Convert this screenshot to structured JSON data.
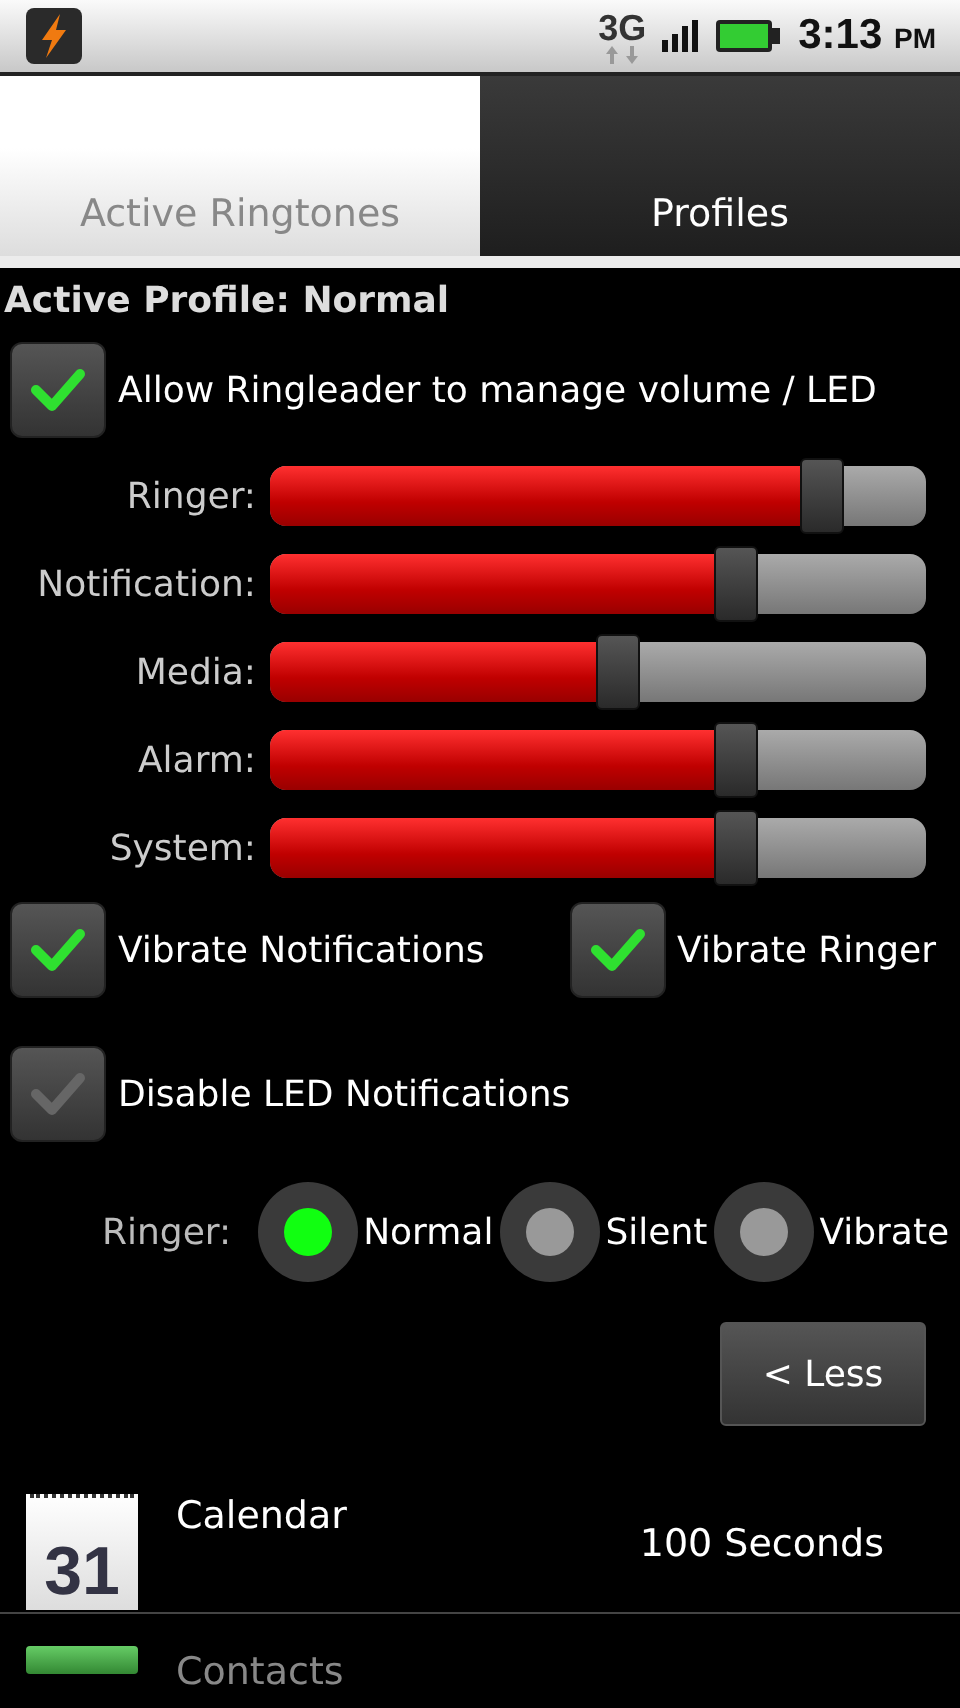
{
  "status_bar": {
    "network": "3G",
    "time": "3:13",
    "ampm": "PM"
  },
  "tabs": [
    {
      "label": "Active Ringtones",
      "selected": false
    },
    {
      "label": "Profiles",
      "selected": true
    }
  ],
  "profile_title": "Active Profile: Normal",
  "manage": {
    "label": "Allow Ringleader to manage volume / LED",
    "checked": true
  },
  "volumes": [
    {
      "name": "Ringer:",
      "level": 0.84
    },
    {
      "name": "Notification:",
      "level": 0.71
    },
    {
      "name": "Media:",
      "level": 0.53
    },
    {
      "name": "Alarm:",
      "level": 0.71
    },
    {
      "name": "System:",
      "level": 0.71
    }
  ],
  "vibrate": [
    {
      "label": "Vibrate Notifications",
      "checked": true
    },
    {
      "label": "Vibrate Ringer",
      "checked": true
    }
  ],
  "disable_led": {
    "label": "Disable LED Notifications",
    "checked": false
  },
  "ringer_mode": {
    "label": "Ringer:",
    "options": [
      {
        "label": "Normal",
        "selected": true
      },
      {
        "label": "Silent",
        "selected": false
      },
      {
        "label": "Vibrate",
        "selected": false
      }
    ]
  },
  "less_button": "< Less",
  "events": [
    {
      "icon_text": "31",
      "name": "Calendar",
      "duration": "100 Seconds"
    },
    {
      "name": "Contacts"
    }
  ]
}
